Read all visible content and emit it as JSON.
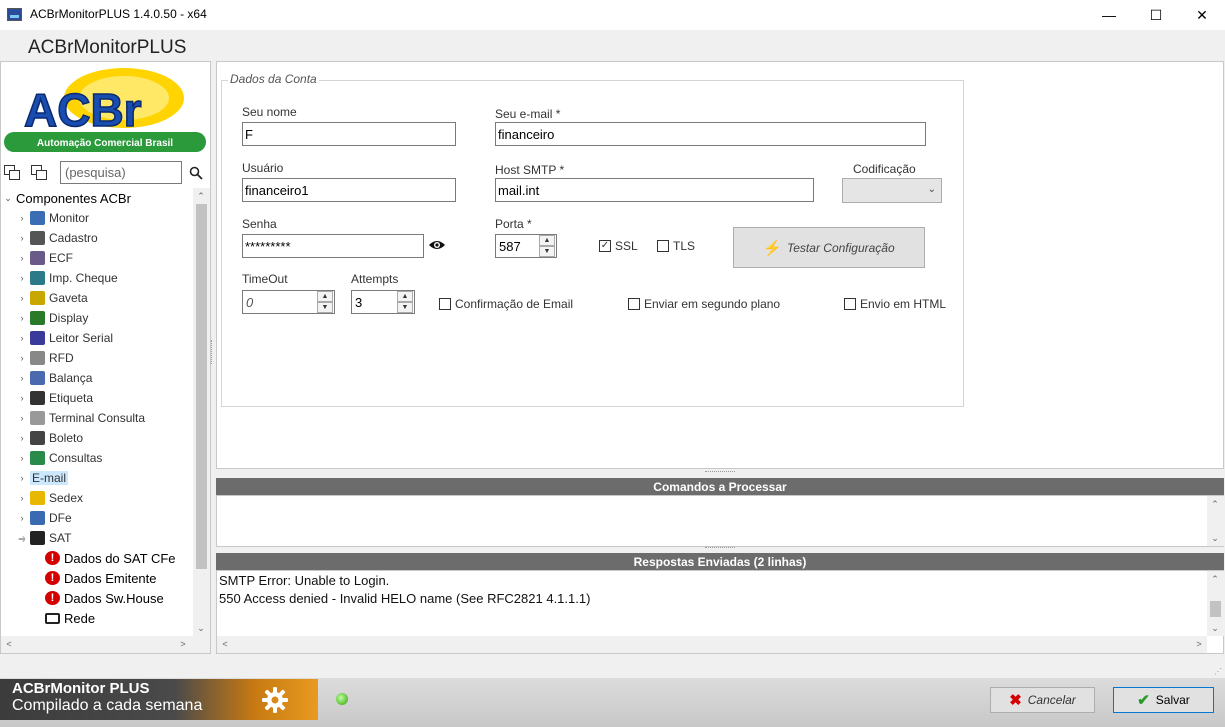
{
  "window": {
    "title": "ACBrMonitorPLUS 1.4.0.50 - x64",
    "controls": {
      "minimize": "—",
      "maximize": "☐",
      "close": "✕"
    }
  },
  "app_title": "ACBrMonitorPLUS",
  "logo": {
    "text": "ACBr",
    "tagline": "Automação Comercial Brasil"
  },
  "search": {
    "placeholder": "(pesquisa)"
  },
  "tree": {
    "root": "Componentes ACBr",
    "items": [
      {
        "label": "Monitor",
        "icon": "monitor-icon",
        "color": "#3b6db5"
      },
      {
        "label": "Cadastro",
        "icon": "edit-icon",
        "color": "#555555"
      },
      {
        "label": "ECF",
        "icon": "printer-icon",
        "color": "#6a5a8a"
      },
      {
        "label": "Imp. Cheque",
        "icon": "cheque-printer-icon",
        "color": "#2a7a8a"
      },
      {
        "label": "Gaveta",
        "icon": "cash-drawer-icon",
        "color": "#c8a800"
      },
      {
        "label": "Display",
        "icon": "display-icon",
        "color": "#2a7a2a"
      },
      {
        "label": "Leitor Serial",
        "icon": "barcode-reader-icon",
        "color": "#3a3a9a"
      },
      {
        "label": "RFD",
        "icon": "database-icon",
        "color": "#888888"
      },
      {
        "label": "Balança",
        "icon": "scale-icon",
        "color": "#4a6ab0"
      },
      {
        "label": "Etiqueta",
        "icon": "label-printer-icon",
        "color": "#333333"
      },
      {
        "label": "Terminal Consulta",
        "icon": "database-icon",
        "color": "#999999"
      },
      {
        "label": "Boleto",
        "icon": "barcode-icon",
        "color": "#444444"
      },
      {
        "label": "Consultas",
        "icon": "globe-icon",
        "color": "#2a8a4a"
      },
      {
        "label": "E-mail",
        "icon": "",
        "color": "",
        "selected": true
      },
      {
        "label": "Sedex",
        "icon": "sedex-icon",
        "color": "#e8b800"
      },
      {
        "label": "DFe",
        "icon": "dfe-icon",
        "color": "#3a6ab0"
      },
      {
        "label": "SAT",
        "icon": "sat-icon",
        "color": "#222222",
        "expanded": true
      }
    ],
    "sat_children": [
      {
        "label": "Dados do SAT CFe",
        "icon": "alert-icon",
        "glyph": "!"
      },
      {
        "label": "Dados Emitente",
        "icon": "alert-icon",
        "glyph": "!"
      },
      {
        "label": "Dados Sw.House",
        "icon": "alert-icon",
        "glyph": "!"
      },
      {
        "label": "Rede",
        "icon": "folder-icon",
        "glyph": ""
      }
    ]
  },
  "form": {
    "legend": "Dados da Conta",
    "seu_nome": {
      "label": "Seu nome",
      "value": "F"
    },
    "seu_email": {
      "label": "Seu e-mail *",
      "value": "financeiro"
    },
    "usuario": {
      "label": "Usuário",
      "value": "financeiro1"
    },
    "host_smtp": {
      "label": "Host SMTP *",
      "value": "mail.int"
    },
    "codificacao": {
      "label": "Codificação",
      "value": ""
    },
    "senha": {
      "label": "Senha",
      "value": "*********"
    },
    "porta": {
      "label": "Porta *",
      "value": "587"
    },
    "ssl": {
      "label": "SSL",
      "checked": true,
      "mark": "✓"
    },
    "tls": {
      "label": "TLS",
      "checked": false
    },
    "test_button": "Testar Configuração",
    "timeout": {
      "label": "TimeOut",
      "value": "0"
    },
    "attempts": {
      "label": "Attempts",
      "value": "3"
    },
    "confirmacao": {
      "label": "Confirmação de Email",
      "checked": false
    },
    "segundo_plano": {
      "label": "Enviar em segundo plano",
      "checked": false
    },
    "envio_html": {
      "label": "Envio em HTML",
      "checked": false
    }
  },
  "comandos": {
    "header": "Comandos a Processar"
  },
  "respostas": {
    "header": "Respostas Enviadas (2 linhas)",
    "lines": [
      "SMTP Error: Unable to Login.",
      "550 Access denied - Invalid HELO name (See RFC2821 4.1.1.1)"
    ]
  },
  "footer": {
    "banner_title": "ACBrMonitor PLUS",
    "banner_subtitle": "Compilado a cada semana",
    "cancel": "Cancelar",
    "save": "Salvar",
    "status_color": "#2fa000"
  }
}
